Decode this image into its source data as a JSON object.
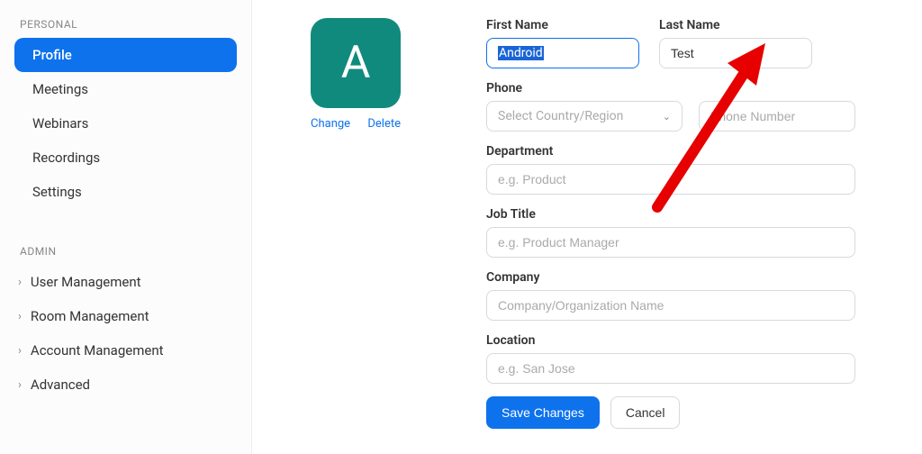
{
  "sidebar": {
    "personal_header": "PERSONAL",
    "personal_items": [
      {
        "label": "Profile",
        "active": true
      },
      {
        "label": "Meetings",
        "active": false
      },
      {
        "label": "Webinars",
        "active": false
      },
      {
        "label": "Recordings",
        "active": false
      },
      {
        "label": "Settings",
        "active": false
      }
    ],
    "admin_header": "ADMIN",
    "admin_items": [
      {
        "label": "User Management"
      },
      {
        "label": "Room Management"
      },
      {
        "label": "Account Management"
      },
      {
        "label": "Advanced"
      }
    ]
  },
  "avatar": {
    "initial": "A",
    "change": "Change",
    "delete": "Delete"
  },
  "form": {
    "first_name_label": "First Name",
    "first_name_value": "Android",
    "last_name_label": "Last Name",
    "last_name_value": "Test",
    "phone_label": "Phone",
    "country_placeholder": "Select Country/Region",
    "phone_placeholder": "Phone Number",
    "department_label": "Department",
    "department_placeholder": "e.g. Product",
    "job_label": "Job Title",
    "job_placeholder": "e.g. Product Manager",
    "company_label": "Company",
    "company_placeholder": "Company/Organization Name",
    "location_label": "Location",
    "location_placeholder": "e.g. San Jose",
    "save": "Save Changes",
    "cancel": "Cancel"
  }
}
